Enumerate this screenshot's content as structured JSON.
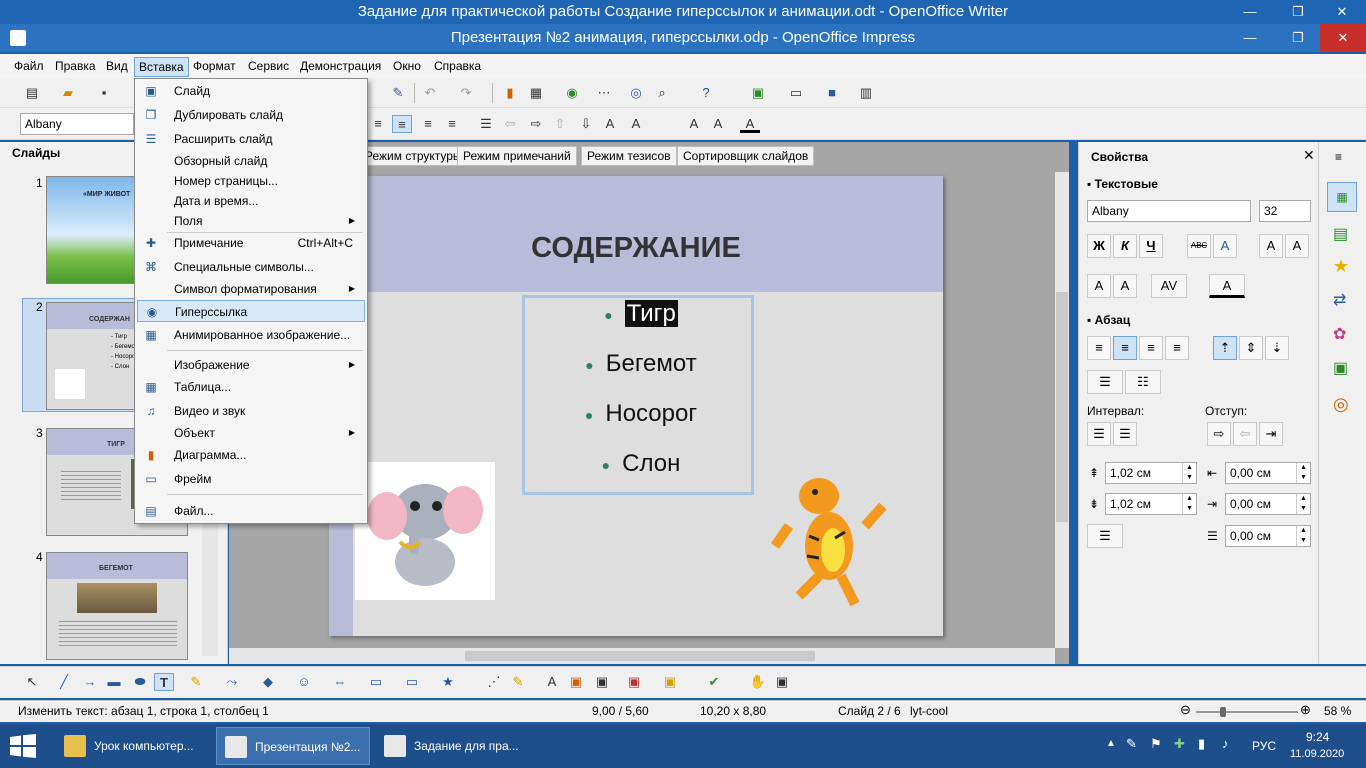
{
  "window": {
    "writer_title": "Задание для практической работы Создание гиперссылок и анимации.odt - OpenOffice Writer",
    "impress_title": "Презентация №2 анимация, гиперссылки.odp - OpenOffice Impress"
  },
  "menubar": [
    "Файл",
    "Правка",
    "Вид",
    "Вставка",
    "Формат",
    "Сервис",
    "Демонстрация",
    "Окно",
    "Справка"
  ],
  "formatbar": {
    "font_name": "Albany"
  },
  "slides_panel": {
    "title": "Слайды",
    "slides": [
      {
        "num": "1",
        "title": "«МИР ЖИВОТ"
      },
      {
        "num": "2",
        "title": "СОДЕРЖАН",
        "items": [
          "- Тигр",
          "- Бегемот",
          "- Носорог",
          "- Слон"
        ]
      },
      {
        "num": "3",
        "title": "ТИГР"
      },
      {
        "num": "4",
        "title": "БЕГЕМОТ"
      }
    ]
  },
  "view_tabs": [
    "Режим структуры",
    "Режим примечаний",
    "Режим тезисов",
    "Сортировщик слайдов"
  ],
  "slide": {
    "title": "СОДЕРЖАНИЕ",
    "bullets": [
      "Тигр",
      "Бегемот",
      "Носорог",
      "Слон"
    ]
  },
  "insert_menu": {
    "items": [
      {
        "label": "Слайд",
        "icon": "slide-icon"
      },
      {
        "label": "Дублировать слайд",
        "icon": "duplicate-slide-icon"
      },
      {
        "label": "Расширить слайд",
        "icon": "expand-slide-icon"
      },
      {
        "label": "Обзорный слайд",
        "icon": ""
      },
      {
        "label": "Номер страницы...",
        "icon": ""
      },
      {
        "label": "Дата и время...",
        "icon": ""
      },
      {
        "label": "Поля",
        "icon": "",
        "submenu": true
      },
      {
        "label": "Примечание",
        "icon": "comment-icon",
        "shortcut": "Ctrl+Alt+C"
      },
      {
        "label": "Специальные символы...",
        "icon": "special-char-icon"
      },
      {
        "label": "Символ форматирования",
        "icon": "",
        "submenu": true
      },
      {
        "label": "Гиперссылка",
        "icon": "hyperlink-icon",
        "highlighted": true
      },
      {
        "label": "Анимированное изображение...",
        "icon": "animated-image-icon"
      },
      {
        "label": "Изображение",
        "icon": "",
        "submenu": true
      },
      {
        "label": "Таблица...",
        "icon": "table-icon"
      },
      {
        "label": "Видео и звук",
        "icon": "media-icon"
      },
      {
        "label": "Объект",
        "icon": "",
        "submenu": true
      },
      {
        "label": "Диаграмма...",
        "icon": "chart-icon"
      },
      {
        "label": "Фрейм",
        "icon": "frame-icon"
      },
      {
        "label": "Файл...",
        "icon": "file-icon"
      }
    ]
  },
  "properties": {
    "title": "Свойства",
    "text_section": "Текстовые",
    "font_name": "Albany",
    "font_size": "32",
    "bold": "Ж",
    "italic": "К",
    "underline": "Ч",
    "strike": "АВС",
    "paragraph_section": "Абзац",
    "spacing_label": "Интервал:",
    "indent_label": "Отступ:",
    "space_above": "1,02 см",
    "space_below": "1,02 см",
    "indent_before": "0,00 см",
    "indent_after": "0,00 см",
    "first_line": "0,00 см"
  },
  "status": {
    "edit": "Изменить текст: абзац 1, строка 1, столбец 1",
    "position": "9,00 / 5,60",
    "size": "10,20 x 8,80",
    "slide": "Слайд 2 / 6",
    "layout": "lyt-cool",
    "zoom": "58 %"
  },
  "taskbar": {
    "items": [
      "Урок компьютер...",
      "Презентация №2...",
      "Задание для пра..."
    ],
    "lang": "РУС",
    "time": "9:24",
    "date": "11.09.2020"
  }
}
